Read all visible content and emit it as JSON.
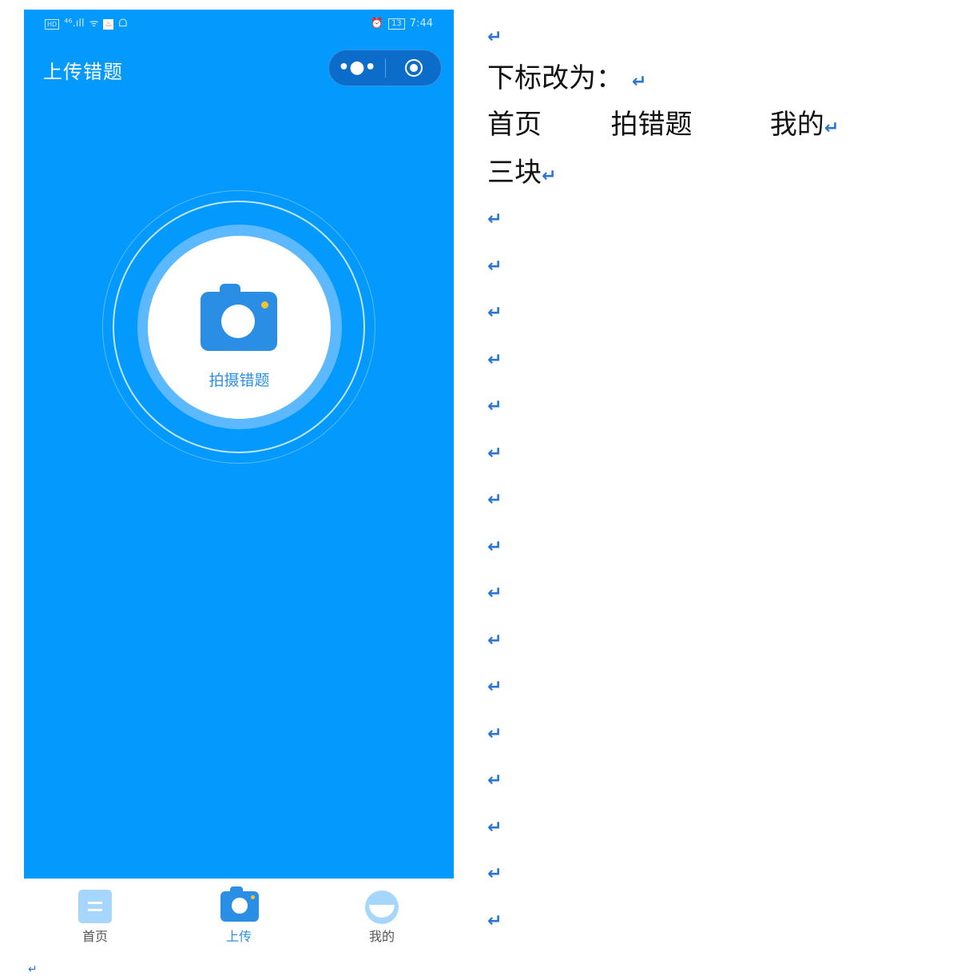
{
  "phone": {
    "status_bar": {
      "left_hd": "HD",
      "left_signal": "⁴⁶.ıll",
      "left_wifi": "ᯤ",
      "left_badge": "♨",
      "left_extra": "ᗝ",
      "right_alarm": "⏰",
      "right_battery": "13",
      "right_time": "7:44"
    },
    "nav_title": "上传错题",
    "capsule": {
      "more_icon": "•●•",
      "close_icon": "target-icon"
    },
    "capture_button": {
      "label": "拍摄错题",
      "icon": "camera-icon"
    },
    "colors": {
      "background": "#0399fd",
      "accent": "#2a8fe4",
      "camera_dot": "#f5c330"
    },
    "tabbar": [
      {
        "label": "首页",
        "icon": "home-icon"
      },
      {
        "label": "上传",
        "icon": "camera-icon",
        "active": true
      },
      {
        "label": "我的",
        "icon": "profile-icon"
      }
    ]
  },
  "document": {
    "paragraph_mark": "↵",
    "lines": [
      "",
      "下标改为：",
      "首页        拍错题         我的",
      "三块"
    ],
    "empty_paragraph_count": 16
  }
}
